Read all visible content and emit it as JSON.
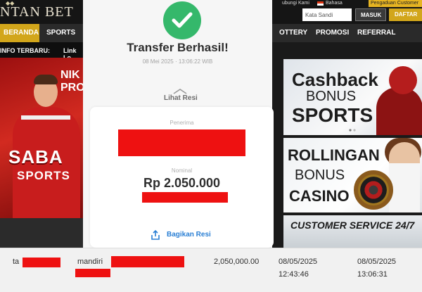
{
  "site": {
    "logo_text": "NTAN BET",
    "nav": [
      "BERANDA",
      "SPORTS",
      "OTTERY",
      "PROMOSI",
      "REFERRAL"
    ],
    "info_label": "INFO TERBARU:",
    "info_link": "Link Lo",
    "topbar": {
      "hub_kami": "ubungi Kami",
      "bahasa": "Bahasa",
      "pengaduan": "Pengaduan Customer",
      "password_placeholder": "Kata Sandi",
      "masuk": "MASUK",
      "daftar": "DAFTAR"
    },
    "left_promo": {
      "nik": "NIK",
      "pro": "PRO",
      "saba": "SABA",
      "sports": "SPORTS"
    },
    "banners": {
      "cashback": [
        "Cashback",
        "BONUS",
        "SPORTS"
      ],
      "rollingan": [
        "ROLLINGAN",
        "BONUS",
        "CASINO"
      ],
      "customer_service": "CUSTOMER SERVICE 24/7"
    }
  },
  "receipt": {
    "title": "Transfer Berhasil!",
    "datetime": "08 Mei 2025 · 13:06:22 WIB",
    "lihat_resi": "Lihat Resi",
    "penerima_label": "Penerima",
    "nominal_label": "Nominal",
    "amount": "Rp 2.050.000",
    "share_label": "Bagikan Resi",
    "colors": {
      "success": "#35b86b",
      "link": "#2a7fd4",
      "redaction": "#ee1111"
    }
  },
  "table": {
    "row": {
      "user": "ta",
      "bank": "mandiri",
      "amount": "2,050,000.00",
      "requested_date": "08/05/2025",
      "requested_time": "12:43:46",
      "processed_date": "08/05/2025",
      "processed_time": "13:06:31"
    }
  }
}
